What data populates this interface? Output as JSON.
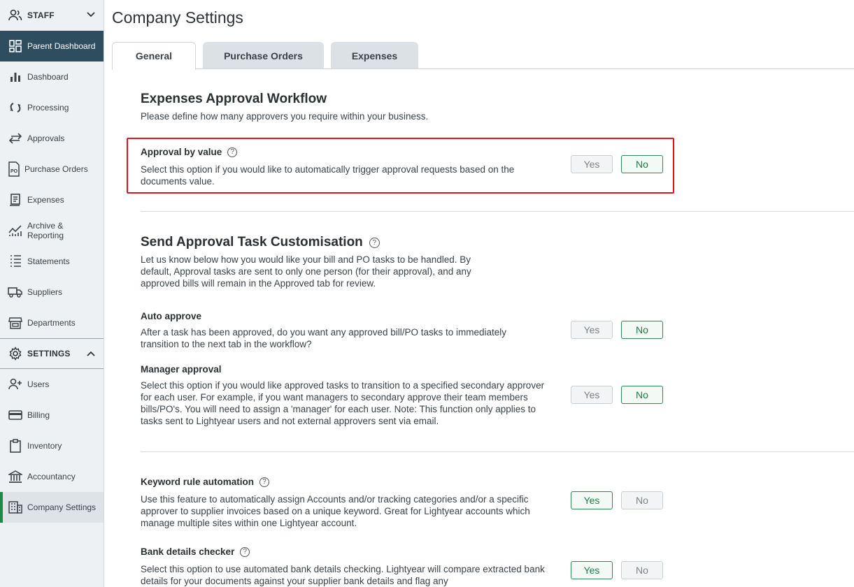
{
  "sidebar": {
    "staff_label": "STAFF",
    "settings_label": "SETTINGS",
    "staff_items": [
      {
        "label": "Parent Dashboard",
        "icon": "dashboard-grid-icon"
      },
      {
        "label": "Dashboard",
        "icon": "bar-chart-icon"
      },
      {
        "label": "Processing",
        "icon": "refresh-icon"
      },
      {
        "label": "Approvals",
        "icon": "arrows-icon"
      },
      {
        "label": "Purchase Orders",
        "icon": "po-document-icon"
      },
      {
        "label": "Expenses",
        "icon": "receipt-icon"
      },
      {
        "label": "Archive & Reporting",
        "icon": "trend-chart-icon"
      },
      {
        "label": "Statements",
        "icon": "list-icon"
      },
      {
        "label": "Suppliers",
        "icon": "truck-icon"
      },
      {
        "label": "Departments",
        "icon": "store-icon"
      }
    ],
    "settings_items": [
      {
        "label": "Users",
        "icon": "add-user-icon"
      },
      {
        "label": "Billing",
        "icon": "credit-card-icon"
      },
      {
        "label": "Inventory",
        "icon": "clipboard-icon"
      },
      {
        "label": "Accountancy",
        "icon": "bank-icon"
      },
      {
        "label": "Company Settings",
        "icon": "building-icon"
      }
    ]
  },
  "main": {
    "title": "Company Settings",
    "tabs": [
      "General",
      "Purchase Orders",
      "Expenses"
    ],
    "expenses_section": {
      "title": "Expenses Approval Workflow",
      "description": "Please define how many approvers you require within your business."
    },
    "approval_by_value": {
      "title": "Approval by value",
      "description": "Select this option if you would like to automatically trigger approval requests based on the documents value.",
      "selected": "No"
    },
    "send_section": {
      "title": "Send Approval Task Customisation",
      "description": "Let us know below how you would like your bill and PO tasks to be handled. By default, Approval tasks are sent to only one person (for their approval), and any approved bills will remain in the Approved tab for review."
    },
    "auto_approve": {
      "title": "Auto approve",
      "description": "After a task has been approved, do you want any approved bill/PO tasks to immediately transition to the next tab in the workflow?",
      "selected": "No"
    },
    "manager_approval": {
      "title": "Manager approval",
      "description": "Select this option if you would like approved tasks to transition to a specified secondary approver for each user. For example, if you want managers to secondary approve their team members bills/PO's. You will need to assign a 'manager' for each user. Note: This function only applies to tasks sent to Lightyear users and not external approvers sent via email.",
      "selected": "No"
    },
    "keyword_rule": {
      "title": "Keyword rule automation",
      "description": "Use this feature to automatically assign Accounts and/or tracking categories and/or a specific approver to supplier invoices based on a unique keyword. Great for Lightyear accounts which manage multiple sites within one Lightyear account.",
      "selected": "Yes"
    },
    "bank_checker": {
      "title": "Bank details checker",
      "description": "Select this option to use automated bank details checking. Lightyear will compare extracted bank details for your documents against your supplier bank details and flag any",
      "selected": "Yes"
    },
    "yes_label": "Yes",
    "no_label": "No"
  },
  "colors": {
    "sidebar_active_dark": "#2e4d5f",
    "accent_green": "#1e8a48",
    "highlight_red": "#e0141c"
  }
}
